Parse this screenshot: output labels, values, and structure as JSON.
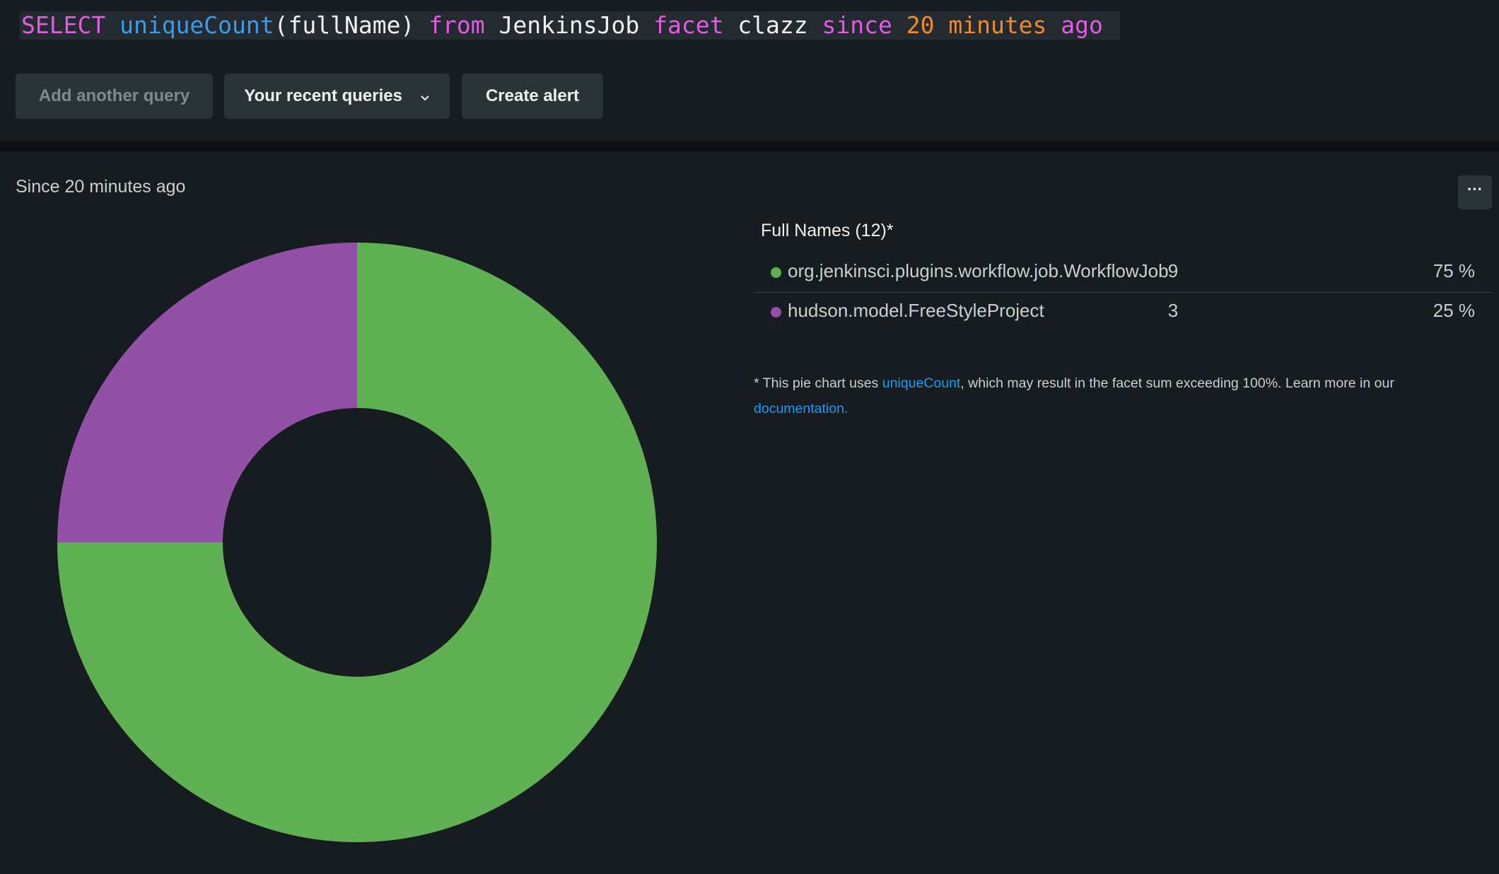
{
  "query": {
    "tokens": [
      {
        "text": "SELECT",
        "kind": "kw"
      },
      {
        "text": " ",
        "kind": "plain"
      },
      {
        "text": "uniqueCount",
        "kind": "fn"
      },
      {
        "text": "(fullName) ",
        "kind": "plain"
      },
      {
        "text": "from",
        "kind": "kw"
      },
      {
        "text": " JenkinsJob ",
        "kind": "plain"
      },
      {
        "text": "facet",
        "kind": "kw"
      },
      {
        "text": " clazz ",
        "kind": "plain"
      },
      {
        "text": "since",
        "kind": "kw"
      },
      {
        "text": " ",
        "kind": "plain"
      },
      {
        "text": "20 minutes",
        "kind": "num"
      },
      {
        "text": " ",
        "kind": "plain"
      },
      {
        "text": "ago",
        "kind": "kw"
      }
    ],
    "colors": {
      "kw": "#e25be2",
      "fn": "#3b9bec",
      "num": "#f08a2c",
      "plain": "#f0f1f1"
    }
  },
  "toolbar": {
    "add_query_label": "Add another query",
    "recent_queries_label": "Your recent queries",
    "create_alert_label": "Create alert"
  },
  "panel": {
    "since_label": "Since 20 minutes ago",
    "more_label": "···"
  },
  "chart_data": {
    "type": "pie",
    "donut": true,
    "title": "Full Names (12)*",
    "slices": [
      {
        "label": "org.jenkinsci.plugins.workflow.job.WorkflowJob",
        "value": 9,
        "percent": "75 %",
        "color": "#5fb153"
      },
      {
        "label": "hudson.model.FreeStyleProject",
        "value": 3,
        "percent": "25 %",
        "color": "#9350a7"
      }
    ],
    "legend_placement": "right"
  },
  "footnote": {
    "prefix": "* This pie chart uses ",
    "link1": "uniqueCount",
    "middle": ", which may result in the facet sum exceeding 100%. Learn more in our ",
    "link2": "documentation."
  }
}
